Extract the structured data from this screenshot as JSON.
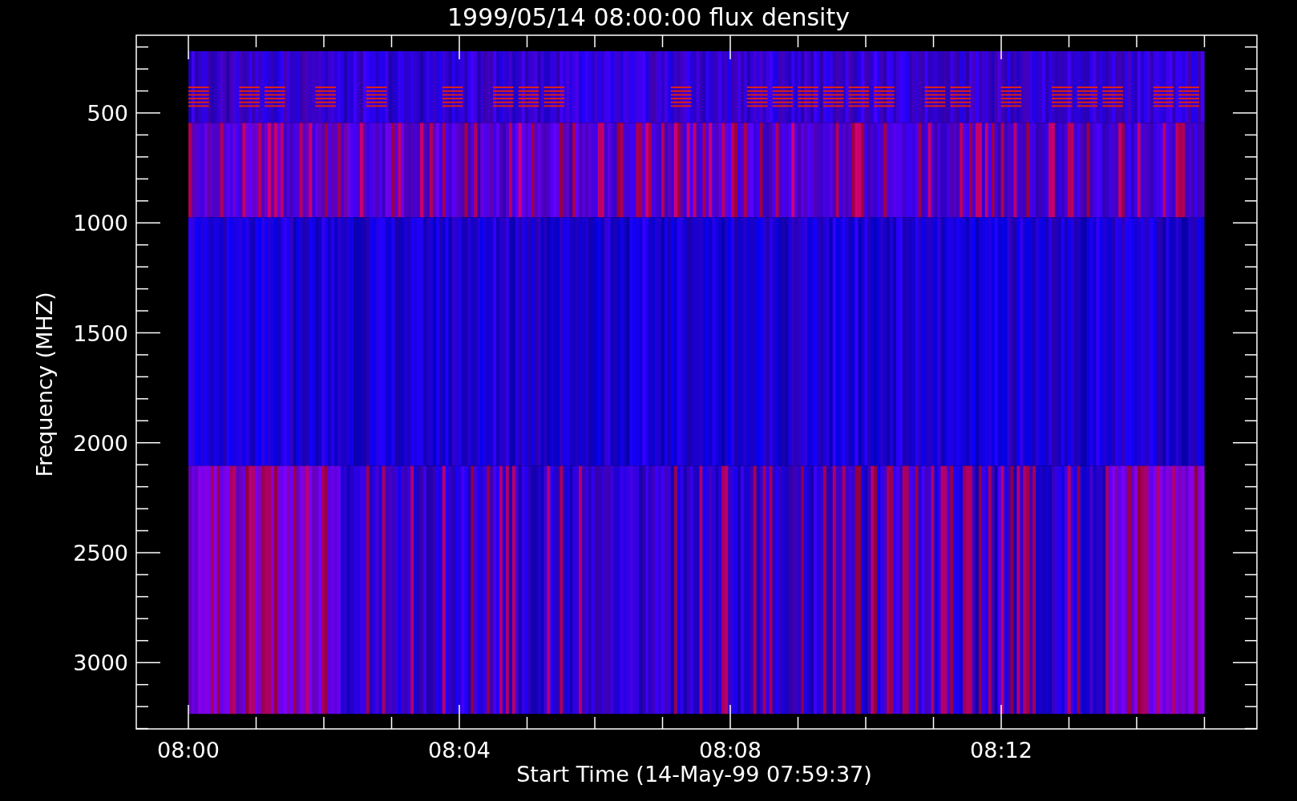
{
  "title": "1999/05/14 08:00:00 flux density",
  "y_axis": {
    "label": "Frequency (MHZ)",
    "ticks": [
      "500",
      "1000",
      "1500",
      "2000",
      "2500",
      "3000"
    ]
  },
  "x_axis": {
    "label": "Start Time (14-May-99 07:59:37)",
    "ticks": [
      "08:00",
      "08:04",
      "08:08",
      "08:12"
    ]
  }
}
